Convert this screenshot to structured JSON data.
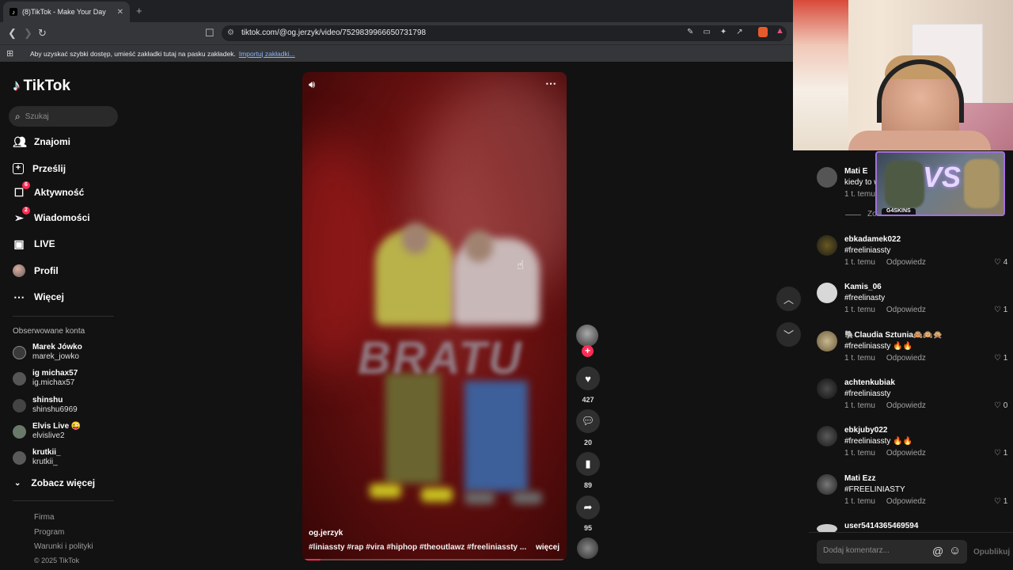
{
  "browser": {
    "tab_title": "(8)TikTok - Make Your Day",
    "url": "tiktok.com/@og.jerzyk/video/7529839966650731798",
    "bookmarks_hint": "Aby uzyskać szybki dostęp, umieść zakładki tutaj na pasku zakładek.",
    "bookmarks_import": "Importuj zakładki..."
  },
  "sidebar": {
    "logo": "TikTok",
    "search_placeholder": "Szukaj",
    "nav": [
      {
        "label": "Znajomi",
        "icon": "friends-icon"
      },
      {
        "label": "Prześlij",
        "icon": "upload-icon"
      },
      {
        "label": "Aktywność",
        "icon": "activity-icon",
        "badge": "6"
      },
      {
        "label": "Wiadomości",
        "icon": "messages-icon",
        "badge": "2"
      },
      {
        "label": "LIVE",
        "icon": "live-icon"
      },
      {
        "label": "Profil",
        "icon": "profile-icon"
      },
      {
        "label": "Więcej",
        "icon": "more-icon"
      }
    ],
    "followed_title": "Obserwowane konta",
    "followed": [
      {
        "name": "Marek Jówko",
        "handle": "marek_jowko"
      },
      {
        "name": "ig michax57",
        "handle": "ig.michax57"
      },
      {
        "name": "shinshu",
        "handle": "shinshu6969"
      },
      {
        "name": "Elvis Live 😜",
        "handle": "elvislive2"
      },
      {
        "name": "krutkii_",
        "handle": "krutkii_"
      }
    ],
    "see_more": "Zobacz więcej",
    "footer": [
      "Firma",
      "Program",
      "Warunki i polityki",
      "© 2025 TikTok"
    ]
  },
  "video": {
    "overlay_text": "BRATU",
    "author": "og.jerzyk",
    "tags": "#liniassty  #rap  #vira  #hiphop  #theoutlawz  #freeliniassty  ...",
    "more": "więcej",
    "progress": 0.07,
    "likes": "427",
    "comments": "20",
    "saves": "89",
    "shares": "95"
  },
  "comments": {
    "first": {
      "name": "Mati E",
      "text": "kiedy to w",
      "time": "1 t. temu"
    },
    "show_replies": "Zo",
    "list": [
      {
        "name": "ebkadamek022",
        "text": "#freeliniassty",
        "time": "1 t. temu",
        "reply": "Odpowiedz",
        "likes": "4"
      },
      {
        "name": "Kamis_06",
        "text": "#freelinasty",
        "time": "1 t. temu",
        "reply": "Odpowiedz",
        "likes": "1"
      },
      {
        "name": "🐘Claudia Sztunia🙈🙉🙊",
        "text": "#freeliniassty 🔥🔥",
        "time": "1 t. temu",
        "reply": "Odpowiedz",
        "likes": "1"
      },
      {
        "name": "achtenkubiak",
        "text": "#freeliniassty",
        "time": "1 t. temu",
        "reply": "Odpowiedz",
        "likes": "0"
      },
      {
        "name": "ebkjuby022",
        "text": "#freeliniassty 🔥🔥",
        "time": "1 t. temu",
        "reply": "Odpowiedz",
        "likes": "1"
      },
      {
        "name": "Mati Ezz",
        "text": "#FREELINIASTY",
        "time": "1 t. temu",
        "reply": "Odpowiedz",
        "likes": "1"
      }
    ],
    "last_name": "user5414365469594",
    "input_placeholder": "Dodaj komentarz...",
    "publish": "Opublikuj"
  },
  "overlay": {
    "skins_label": "G4SKINS",
    "vs_text": "VS"
  },
  "colors": {
    "accent": "#fe2c55",
    "background": "#121212"
  }
}
